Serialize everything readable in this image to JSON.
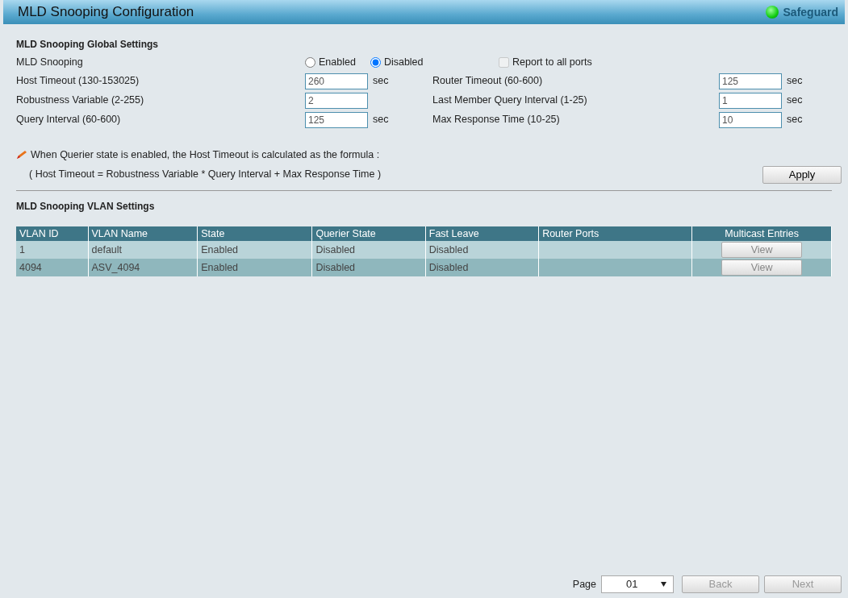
{
  "header": {
    "title": "MLD Snooping Configuration",
    "status_label": "Safeguard"
  },
  "global": {
    "title": "MLD Snooping Global Settings",
    "snooping": {
      "label": "MLD Snooping",
      "options": [
        {
          "label": "Enabled",
          "selected": false
        },
        {
          "label": "Disabled",
          "selected": true
        }
      ],
      "report": {
        "label": "Report to all ports",
        "checked": false,
        "disabled": true
      }
    },
    "rows": [
      {
        "left": {
          "label": "Host Timeout (130-153025)",
          "value": "260",
          "unit": "sec"
        },
        "right": {
          "label": "Router Timeout (60-600)",
          "value": "125",
          "unit": "sec"
        }
      },
      {
        "left": {
          "label": "Robustness Variable (2-255)",
          "value": "2"
        },
        "right": {
          "label": "Last Member Query Interval (1-25)",
          "value": "1",
          "unit": "sec"
        }
      },
      {
        "left": {
          "label": "Query Interval (60-600)",
          "value": "125",
          "unit": "sec"
        },
        "right": {
          "label": "Max Response Time (10-25)",
          "value": "10",
          "unit": "sec"
        }
      }
    ],
    "note": "When Querier state is enabled, the Host Timeout is calculated as the formula :",
    "formula": "( Host Timeout = Robustness Variable * Query Interval + Max Response Time )",
    "apply": "Apply"
  },
  "vlan": {
    "title": "MLD Snooping VLAN Settings",
    "columns": [
      "VLAN ID",
      "VLAN Name",
      "State",
      "Querier State",
      "Fast Leave",
      "Router Ports",
      "Multicast Entries"
    ],
    "rows": [
      {
        "cells": [
          "1",
          "default",
          "Enabled",
          "Disabled",
          "Disabled",
          ""
        ],
        "action": "View"
      },
      {
        "cells": [
          "4094",
          "ASV_4094",
          "Enabled",
          "Disabled",
          "Disabled",
          ""
        ],
        "action": "View"
      }
    ]
  },
  "pager": {
    "label": "Page",
    "value": "01",
    "back": {
      "label": "Back",
      "disabled": true
    },
    "next": {
      "label": "Next",
      "disabled": true
    }
  }
}
